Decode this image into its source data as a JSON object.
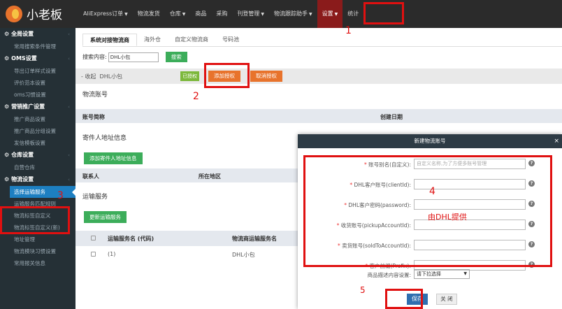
{
  "app": {
    "name": "小老板"
  },
  "nav": {
    "items": [
      {
        "label": "AliExpress订单",
        "caret": true
      },
      {
        "label": "物流发货",
        "caret": false
      },
      {
        "label": "仓库",
        "caret": true
      },
      {
        "label": "商品",
        "caret": false
      },
      {
        "label": "采购",
        "caret": false
      },
      {
        "label": "刊登管理",
        "caret": true
      },
      {
        "label": "物流跟踪助手",
        "caret": true
      },
      {
        "label": "设置",
        "caret": true
      },
      {
        "label": "统计",
        "caret": false
      }
    ],
    "active_index": 7
  },
  "sidebar": {
    "groups": [
      {
        "label": "全局设置",
        "items": [
          "常用搜索条件管理"
        ]
      },
      {
        "label": "OMS设置",
        "items": [
          "导出订单样式设置",
          "评价范本设置",
          "oms习惯设置"
        ]
      },
      {
        "label": "营销推广设置",
        "items": [
          "推广商品设置",
          "推广商品分组设置",
          "发信模板设置"
        ]
      },
      {
        "label": "仓库设置",
        "items": [
          "自营仓库"
        ]
      },
      {
        "label": "物流设置",
        "items": [
          "选择运输服务",
          "运输服务匹配规则",
          "物流标签自定义",
          "物流标签自定义(新)",
          "地址管理",
          "物流模块习惯设置",
          "常用报关信息"
        ]
      }
    ],
    "active_item": "选择运输服务"
  },
  "main": {
    "tabs": [
      "系统对接物流商",
      "海外仓",
      "自定义物流商",
      "号码池"
    ],
    "search_label": "搜索内容:",
    "search_value": "DHL小包",
    "search_button": "搜索",
    "carrier_collapse": "- 收起",
    "carrier_name": "DHL小包",
    "status_badge": "已授权",
    "add_auth_button": "添加授权",
    "cancel_auth_button": "取消授权",
    "account_section": "物流账号",
    "account_headers": [
      "账号简称",
      "创建日期"
    ],
    "sender_section": "寄件人地址信息",
    "add_sender_button": "添加寄件人地址信息",
    "sender_headers": [
      "联系人",
      "所在地区"
    ],
    "service_section": "运输服务",
    "update_service_button": "更新运输服务",
    "service_headers": [
      "运输服务名 (代码)",
      "物流商运输服务名"
    ],
    "service_rows": [
      {
        "name": "(1)",
        "provider_name": "DHL小包"
      }
    ]
  },
  "modal": {
    "title": "新建物流账号",
    "close": "×",
    "fields": [
      {
        "label": "账号别名(自定义):",
        "required": true,
        "placeholder": "自定义名称,为了方便多账号管理"
      },
      {
        "label": "DHL客户账号(clientId):",
        "required": true,
        "placeholder": ""
      },
      {
        "label": "DHL客户密码(password):",
        "required": true,
        "placeholder": ""
      },
      {
        "label": "收货账号(pickupAccountId):",
        "required": true,
        "placeholder": ""
      },
      {
        "label": "卖货账号(soldToAccountId):",
        "required": true,
        "placeholder": ""
      },
      {
        "label": "客户前缀(Prefix):",
        "required": true,
        "placeholder": ""
      }
    ],
    "desc_label": "商品描述内容设置:",
    "desc_select": "请下拉选择",
    "save_button": "保存",
    "close_button": "关 闭"
  },
  "annotations": {
    "steps": [
      "1",
      "2",
      "3",
      "4",
      "5"
    ],
    "note": "由DHL提供"
  },
  "colors": {
    "topbar": "#2b2b2b",
    "sidebar": "#253036",
    "active_sidebar": "#1d7fc1",
    "accent_orange": "#e8732c",
    "green": "#3cad5a",
    "annotation_red": "#e01010"
  }
}
